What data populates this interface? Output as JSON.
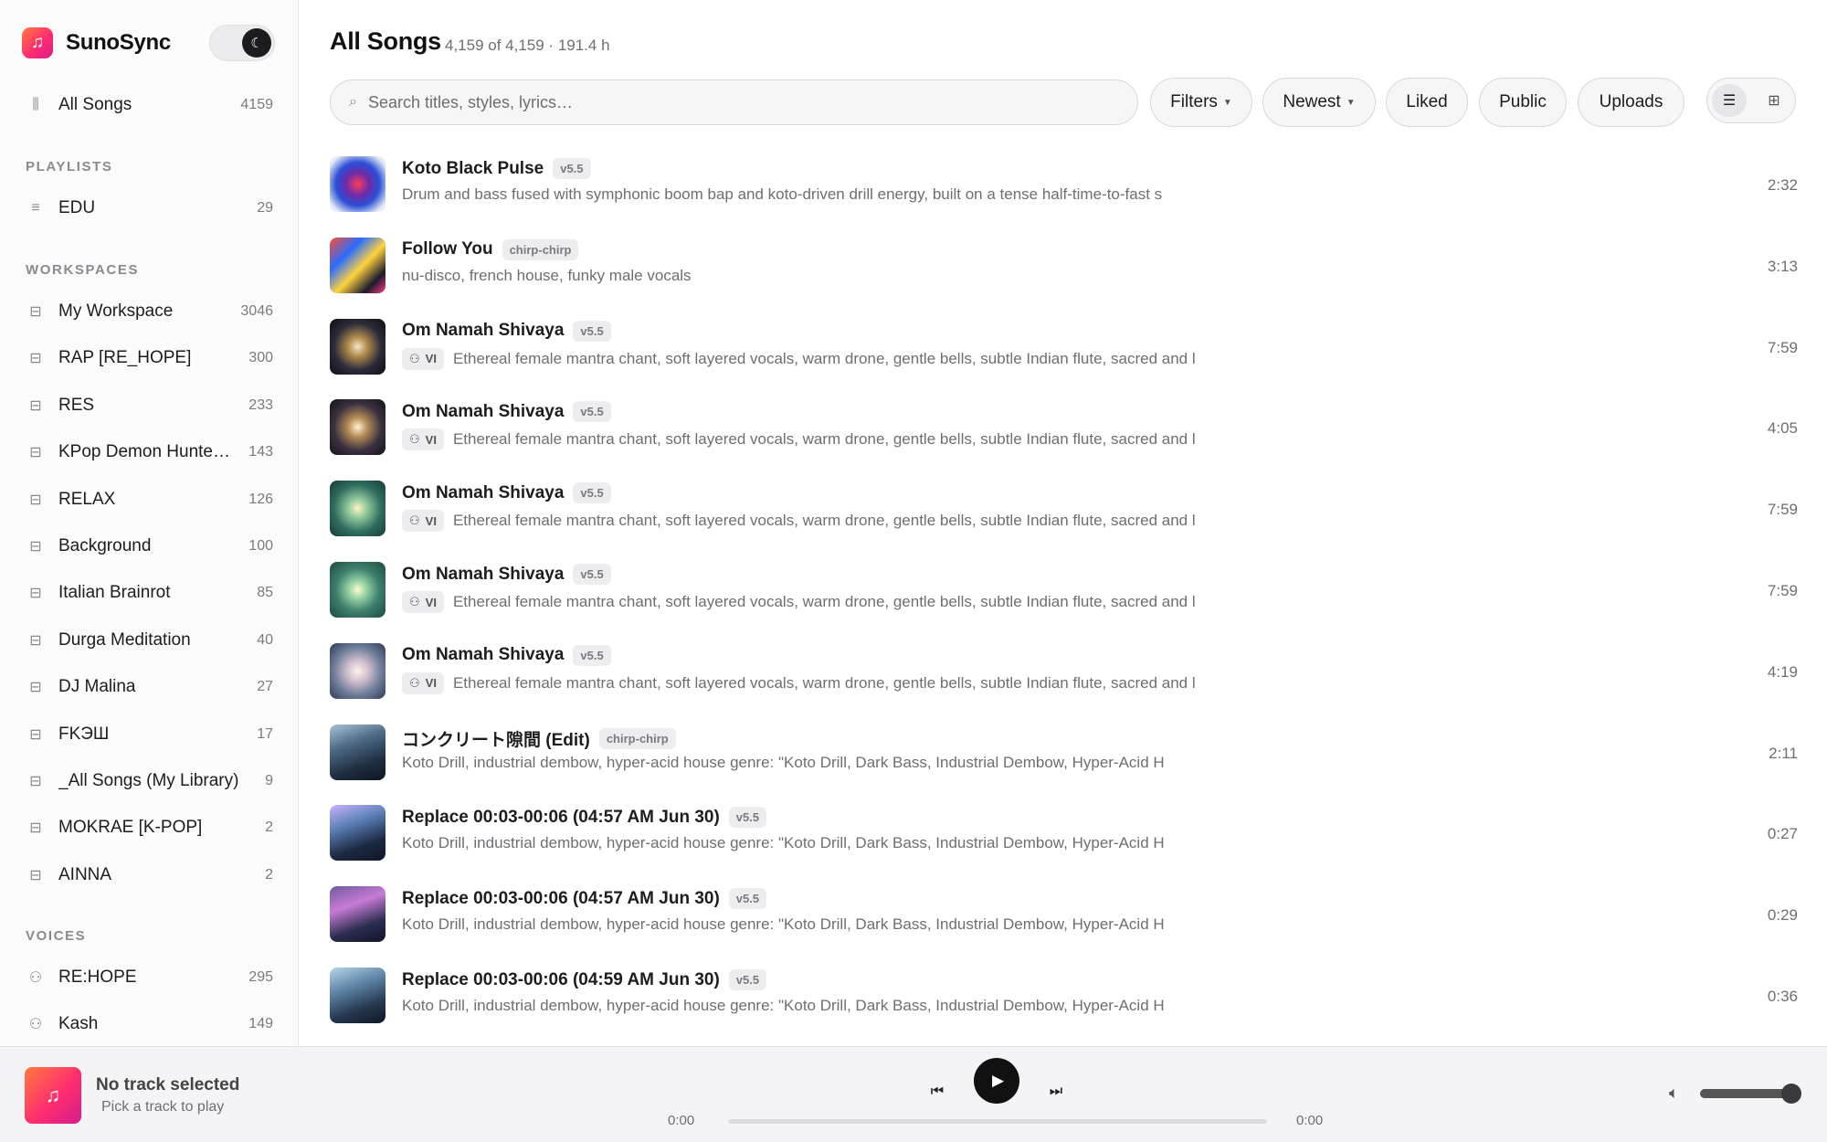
{
  "app": {
    "name": "SunoSync"
  },
  "sidebar": {
    "all_songs": {
      "label": "All Songs",
      "count": "4159"
    },
    "playlists_title": "PLAYLISTS",
    "playlists": [
      {
        "label": "EDU",
        "count": "29"
      }
    ],
    "workspaces_title": "WORKSPACES",
    "workspaces": [
      {
        "label": "My Workspace",
        "count": "3046"
      },
      {
        "label": "RAP [RE_HOPE]",
        "count": "300"
      },
      {
        "label": "RES",
        "count": "233"
      },
      {
        "label": "KPop Demon Hunte…",
        "count": "143"
      },
      {
        "label": "RELAX",
        "count": "126"
      },
      {
        "label": "Background",
        "count": "100"
      },
      {
        "label": "Italian Brainrot",
        "count": "85"
      },
      {
        "label": "Durga Meditation",
        "count": "40"
      },
      {
        "label": "DJ Malina",
        "count": "27"
      },
      {
        "label": "FKЭШ",
        "count": "17"
      },
      {
        "label": "_All Songs (My Library)",
        "count": "9"
      },
      {
        "label": "MOKRAE [K-POP]",
        "count": "2"
      },
      {
        "label": "AINNA",
        "count": "2"
      }
    ],
    "voices_title": "VOICES",
    "voices": [
      {
        "label": "RE:HOPE",
        "count": "295"
      },
      {
        "label": "Kash",
        "count": "149"
      }
    ]
  },
  "main": {
    "title": "All Songs",
    "subtitle": "4,159 of 4,159 · 191.4 h",
    "search_placeholder": "Search titles, styles, lyrics…",
    "filters": {
      "filters": "Filters",
      "sort": "Newest",
      "liked": "Liked",
      "public": "Public",
      "uploads": "Uploads"
    },
    "songs": [
      {
        "title": "Koto Black Pulse",
        "tag": "v5.5",
        "voice": "",
        "desc": "Drum and bass fused with symphonic boom bap and koto-driven drill energy, built on a tense half-time-to-fast s",
        "duration": "2:32"
      },
      {
        "title": "Follow You",
        "tag": "chirp-chirp",
        "voice": "",
        "desc": "nu-disco, french house, funky male vocals",
        "duration": "3:13"
      },
      {
        "title": "Om Namah Shivaya",
        "tag": "v5.5",
        "voice": "VI",
        "desc": "Ethereal female mantra chant, soft layered vocals, warm drone, gentle bells, subtle Indian flute, sacred and l",
        "duration": "7:59"
      },
      {
        "title": "Om Namah Shivaya",
        "tag": "v5.5",
        "voice": "VI",
        "desc": "Ethereal female mantra chant, soft layered vocals, warm drone, gentle bells, subtle Indian flute, sacred and l",
        "duration": "4:05"
      },
      {
        "title": "Om Namah Shivaya",
        "tag": "v5.5",
        "voice": "VI",
        "desc": "Ethereal female mantra chant, soft layered vocals, warm drone, gentle bells, subtle Indian flute, sacred and l",
        "duration": "7:59"
      },
      {
        "title": "Om Namah Shivaya",
        "tag": "v5.5",
        "voice": "VI",
        "desc": "Ethereal female mantra chant, soft layered vocals, warm drone, gentle bells, subtle Indian flute, sacred and l",
        "duration": "7:59"
      },
      {
        "title": "Om Namah Shivaya",
        "tag": "v5.5",
        "voice": "VI",
        "desc": "Ethereal female mantra chant, soft layered vocals, warm drone, gentle bells, subtle Indian flute, sacred and l",
        "duration": "4:19"
      },
      {
        "title": "コンクリート隙間 (Edit)",
        "tag": "chirp-chirp",
        "voice": "",
        "desc": "Koto Drill, industrial dembow, hyper-acid house genre: \"Koto Drill, Dark Bass, Industrial Dembow, Hyper-Acid H",
        "duration": "2:11"
      },
      {
        "title": "Replace 00:03-00:06 (04:57 AM Jun 30)",
        "tag": "v5.5",
        "voice": "",
        "desc": "Koto Drill, industrial dembow, hyper-acid house genre: \"Koto Drill, Dark Bass, Industrial Dembow, Hyper-Acid H",
        "duration": "0:27"
      },
      {
        "title": "Replace 00:03-00:06 (04:57 AM Jun 30)",
        "tag": "v5.5",
        "voice": "",
        "desc": "Koto Drill, industrial dembow, hyper-acid house genre: \"Koto Drill, Dark Bass, Industrial Dembow, Hyper-Acid H",
        "duration": "0:29"
      },
      {
        "title": "Replace 00:03-00:06 (04:59 AM Jun 30)",
        "tag": "v5.5",
        "voice": "",
        "desc": "Koto Drill, industrial dembow, hyper-acid house genre: \"Koto Drill, Dark Bass, Industrial Dembow, Hyper-Acid H",
        "duration": "0:36"
      }
    ]
  },
  "player": {
    "title": "No track selected",
    "subtitle": "Pick a track to play",
    "time_current": "0:00",
    "time_total": "0:00",
    "progress": 0,
    "volume": 1.0
  },
  "thumbs": [
    {
      "style": "radial-gradient(circle at 50% 50%, #ff3b5c 0%, #6b2ba8 30%, #2a4fd6 55%, #e8ecf5 85%)"
    },
    {
      "style": "linear-gradient(135deg, #ff4d2e 0%, #2b6cff 30%, #ffd23d 55%, #1a1a2e 80%, #ff3b86 100%)"
    },
    {
      "style": "radial-gradient(circle at 50% 50%, #f5e7c8 0%, #b08a4a 25%, #2b2b3a 60%, #0f0f18 100%)"
    },
    {
      "style": "radial-gradient(circle at 50% 50%, #fff2d6 0%, #b58c55 25%, #3a3140 60%, #14121c 100%)"
    },
    {
      "style": "radial-gradient(circle at 50% 50%, #fff6c4 0%, #8fc79a 25%, #2f6d60 60%, #173b36 100%)"
    },
    {
      "style": "radial-gradient(circle at 50% 50%, #fffbd0 0%, #98d4a4 22%, #3e7f6e 55%, #1c4a40 100%)"
    },
    {
      "style": "radial-gradient(circle at 50% 50%, #fff3ea 0%, #c9b9c9 30%, #6f7e99 60%, #2e3a56 100%)"
    },
    {
      "style": "linear-gradient(160deg, #a8c4d8 0%, #4d6b86 35%, #1f2f42 70%, #0c1520 100%)"
    },
    {
      "style": "linear-gradient(160deg, #c9b4ff 0%, #5a7fb5 35%, #1e2a44 70%, #0e1424 100%)"
    },
    {
      "style": "linear-gradient(160deg, #6d5a9e 0%, #c87bd6 35%, #2a2d4e 70%, #11132a 100%)"
    },
    {
      "style": "linear-gradient(160deg, #b8d6ea 0%, #5f86a8 35%, #26384f 70%, #0e1826 100%)"
    }
  ]
}
